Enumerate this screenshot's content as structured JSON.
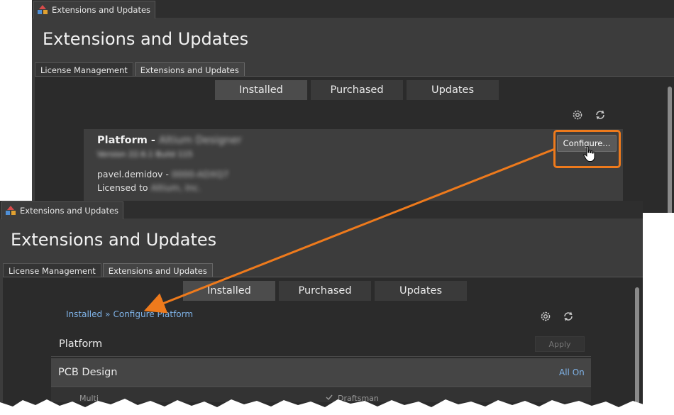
{
  "top_window": {
    "doc_tab": "Extensions and Updates",
    "title": "Extensions and Updates",
    "sub_tabs": [
      "License Management",
      "Extensions and Updates"
    ],
    "segments": [
      "Installed",
      "Purchased",
      "Updates"
    ],
    "platform_card": {
      "title_prefix": "Platform - ",
      "title_hidden": "Altium Designer",
      "version_hidden": "Version 22.6.1 Build 115",
      "user_prefix": "pavel.demidov - ",
      "user_hidden": "0000-ADXQ7",
      "licensed_prefix": "Licensed to ",
      "licensed_hidden": "Altium, Inc.",
      "configure_label": "Configure..."
    }
  },
  "bottom_window": {
    "doc_tab": "Extensions and Updates",
    "title": "Extensions and Updates",
    "sub_tabs": [
      "License Management",
      "Extensions and Updates"
    ],
    "segments": [
      "Installed",
      "Purchased",
      "Updates"
    ],
    "breadcrumb": {
      "root": "Installed",
      "separator": "»",
      "current": "Configure Platform"
    },
    "platform_row_label": "Platform",
    "apply_label": "Apply",
    "pcb_row_label": "PCB Design",
    "all_on_label": "All On",
    "partial_item_left": "Multi",
    "partial_item_right": "Draftsman"
  },
  "colors": {
    "accent_orange": "#ee7a1c",
    "link_blue": "#7fb3e8",
    "panel_bg": "#3c3c3c",
    "content_bg": "#2b2b2b"
  },
  "icons": [
    "app-icon",
    "gear-icon",
    "refresh-icon",
    "hand-cursor-icon",
    "check-icon"
  ]
}
